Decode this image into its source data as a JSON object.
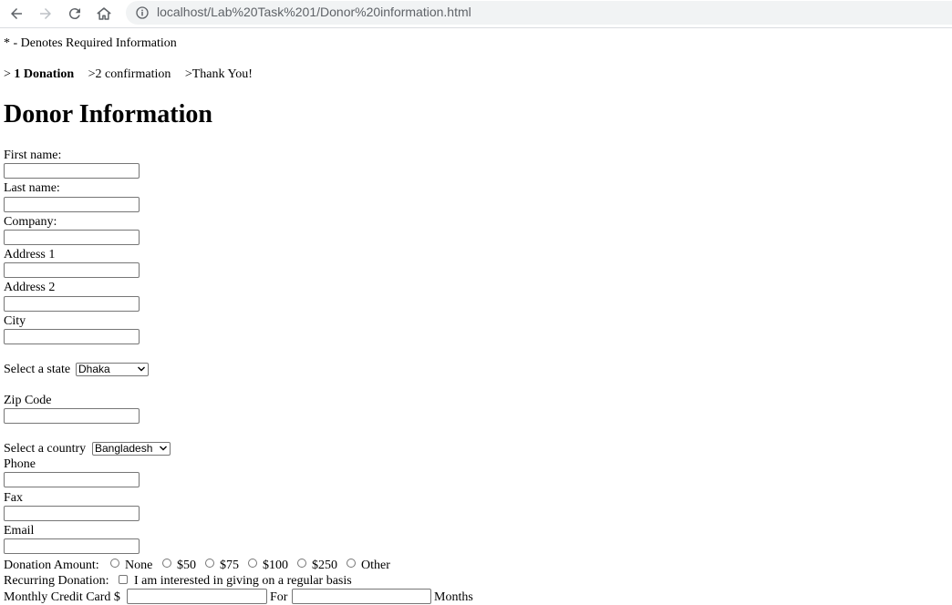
{
  "browser": {
    "url": "localhost/Lab%20Task%201/Donor%20information.html"
  },
  "page": {
    "required_note": "* - Denotes Required Information",
    "steps": {
      "step1_prefix": "> ",
      "step1_bold": "1 Donation",
      "step2": ">2 confirmation",
      "step3": ">Thank You!"
    },
    "title": "Donor Information",
    "fields": {
      "first_name": "First name:",
      "last_name": "Last name:",
      "company": "Company:",
      "address1": "Address 1",
      "address2": "Address 2",
      "city": "City",
      "state_label": "Select a state",
      "state_value": "Dhaka",
      "zip": "Zip Code",
      "country_label": "Select a country",
      "country_value": "Bangladesh",
      "phone": "Phone",
      "fax": "Fax",
      "email": "Email"
    },
    "donation": {
      "label": "Donation Amount:",
      "options": [
        "None",
        "$50",
        "$75",
        "$100",
        "$250",
        "Other"
      ]
    },
    "recurring": {
      "label": "Recurring Donation:",
      "checkbox_text": "I am interested in giving on a regular basis"
    },
    "monthly": {
      "label": "Monthly Credit Card $",
      "for": "For",
      "months": "Months"
    }
  }
}
